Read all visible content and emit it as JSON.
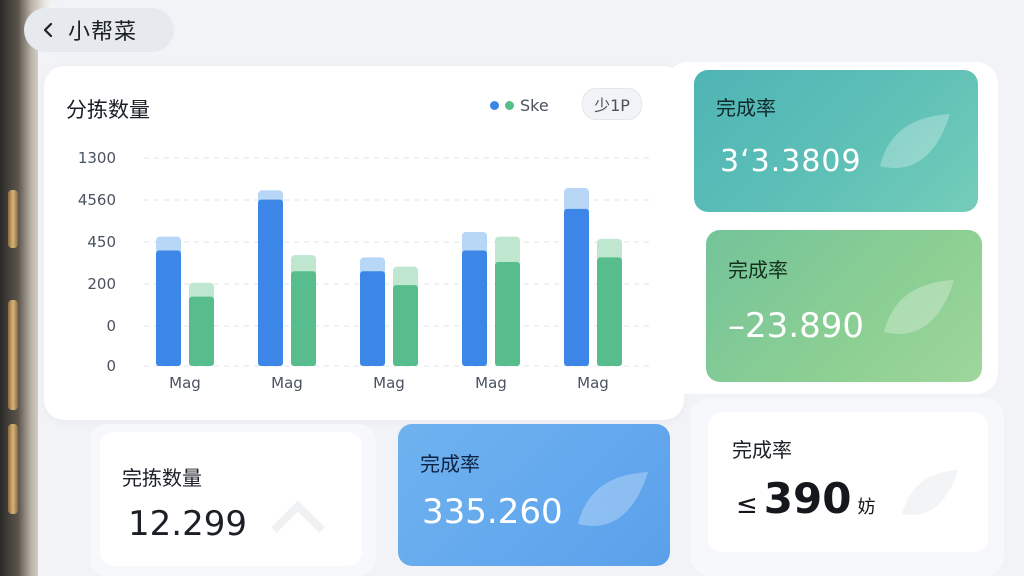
{
  "header": {
    "title": "小帮菜"
  },
  "chart_card": {
    "title": "分拣数量",
    "legend_label": "Ske",
    "chip_label": "少1P"
  },
  "chart_data": {
    "type": "bar",
    "y_tick_labels": [
      "1300",
      "4560",
      "450",
      "200",
      "0",
      "0"
    ],
    "categories": [
      "Mag",
      "Mag",
      "Mag",
      "Mag",
      "Mag"
    ],
    "colors": {
      "blue": "#3b86e6",
      "blue_light": "#b8d6f6",
      "green": "#58bd8d",
      "green_light": "#bfe6cf"
    },
    "series": [
      {
        "name": "Ske",
        "values": [
          5,
          7.2,
          4.1,
          5,
          6.8
        ],
        "caps": [
          0.6,
          0.4,
          0.6,
          0.8,
          0.9
        ]
      },
      {
        "values": [
          3,
          4.1,
          3.5,
          4.5,
          4.7
        ],
        "caps": [
          0.6,
          0.7,
          0.8,
          1.1,
          0.8
        ]
      }
    ],
    "ylim": [
      0,
      9
    ]
  },
  "stats": {
    "teal": {
      "label": "完成率",
      "value": "3‘3.3809"
    },
    "green": {
      "label": "完成率",
      "value": "–23.890"
    },
    "picking": {
      "label": "完拣数量",
      "value": "12.299"
    },
    "blue": {
      "label": "完成率",
      "value": "335.260"
    },
    "white": {
      "label": "完成率",
      "prefix": "≤",
      "value": "390",
      "unit": "妨"
    }
  }
}
